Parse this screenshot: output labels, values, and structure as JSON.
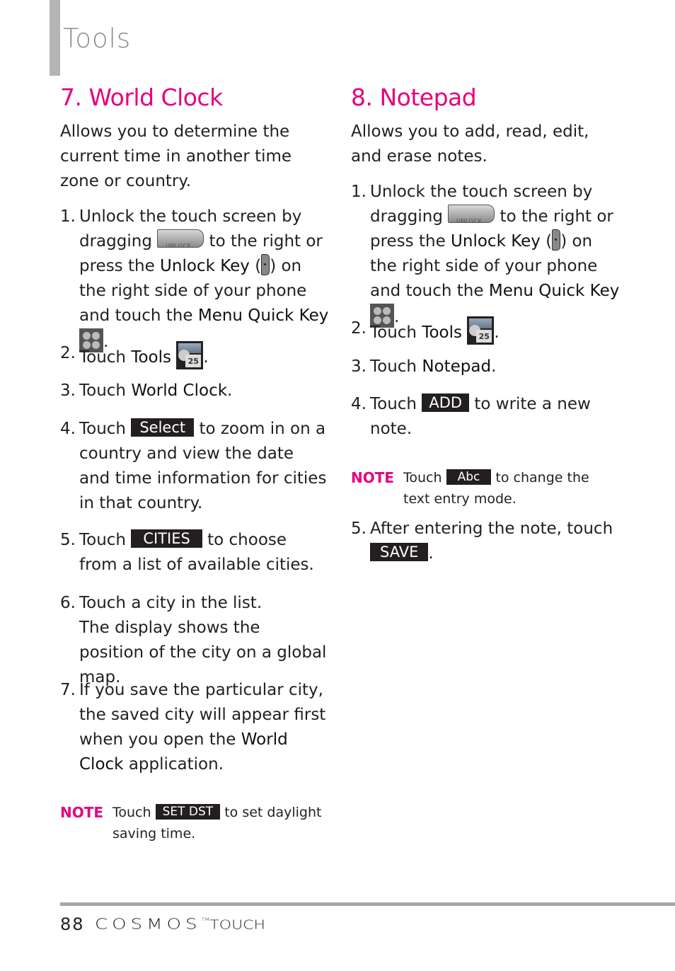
{
  "section_title": "Tools",
  "world_clock": {
    "heading": "7. World Clock",
    "intro": "Allows you to determine the current time in another time zone or country.",
    "steps": [
      {
        "num": "1.",
        "t1": "Unlock the touch screen by dragging",
        "t2": "to the right or press the",
        "unlock_key": "Unlock Key",
        "t3": "(",
        "t4": ") on the right side of your phone and touch the",
        "menu_key": "Menu Quick Key",
        "t5": "."
      },
      {
        "num": "2.",
        "t1": "Touch",
        "bold": "Tools",
        "t2": "."
      },
      {
        "num": "3.",
        "t1": "Touch",
        "bold": "World Clock",
        "t2": "."
      },
      {
        "num": "4.",
        "t1": "Touch",
        "button": "Select",
        "t2": "to zoom in on a country and view the date and time information for cities in that country."
      },
      {
        "num": "5.",
        "t1": "Touch",
        "button": "CITIES",
        "t2": "to choose from a list of available cities."
      },
      {
        "num": "6.",
        "t1": "Touch a city in the list.",
        "t2": "The display shows the position of the city on a global map."
      },
      {
        "num": "7.",
        "t1": "If you save the particular city, the saved city will appear first when you open the",
        "bold": "World Clock",
        "t2": "application."
      }
    ],
    "note": {
      "label": "NOTE",
      "t1": "Touch",
      "button": "SET DST",
      "t2": "to set daylight saving time."
    }
  },
  "notepad": {
    "heading": "8. Notepad",
    "intro": "Allows you to add, read, edit, and erase notes.",
    "steps": [
      {
        "num": "1.",
        "t1": "Unlock the touch screen by dragging",
        "t2": "to the right or press the",
        "unlock_key": "Unlock Key",
        "t3": "(",
        "t4": ") on the right side of your phone and touch the",
        "menu_key": "Menu Quick Key",
        "t5": "."
      },
      {
        "num": "2.",
        "t1": "Touch",
        "bold": "Tools",
        "t2": "."
      },
      {
        "num": "3.",
        "t1": "Touch",
        "bold": "Notepad",
        "t2": "."
      },
      {
        "num": "4.",
        "t1": "Touch",
        "button": "ADD",
        "t2": "to write a new note."
      },
      {
        "num": "5.",
        "t1": "After entering the note, touch",
        "button": "SAVE",
        "t2": "."
      }
    ],
    "note": {
      "label": "NOTE",
      "t1": "Touch",
      "button": "Abc",
      "t2": "to change the text entry mode."
    }
  },
  "icons": {
    "unlock_slider_text": "UNLOCK",
    "calendar_day": "25"
  },
  "footer": {
    "page_number": "88",
    "brand": "COSMOS",
    "tm": "TM",
    "brand_suffix": "TOUCH"
  },
  "colors": {
    "accent": "#e6007e",
    "sidebar": "#b5b4b5",
    "rule": "#a8a7a8"
  }
}
